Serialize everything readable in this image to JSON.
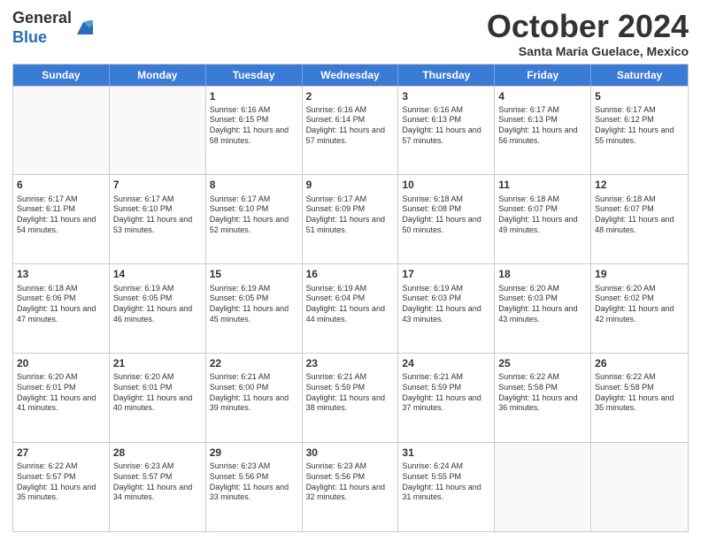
{
  "logo": {
    "general": "General",
    "blue": "Blue"
  },
  "header": {
    "month": "October 2024",
    "location": "Santa Maria Guelace, Mexico"
  },
  "days": [
    "Sunday",
    "Monday",
    "Tuesday",
    "Wednesday",
    "Thursday",
    "Friday",
    "Saturday"
  ],
  "weeks": [
    [
      {
        "day": "",
        "sunrise": "",
        "sunset": "",
        "daylight": "",
        "empty": true
      },
      {
        "day": "",
        "sunrise": "",
        "sunset": "",
        "daylight": "",
        "empty": true
      },
      {
        "day": "1",
        "sunrise": "Sunrise: 6:16 AM",
        "sunset": "Sunset: 6:15 PM",
        "daylight": "Daylight: 11 hours and 58 minutes.",
        "empty": false
      },
      {
        "day": "2",
        "sunrise": "Sunrise: 6:16 AM",
        "sunset": "Sunset: 6:14 PM",
        "daylight": "Daylight: 11 hours and 57 minutes.",
        "empty": false
      },
      {
        "day": "3",
        "sunrise": "Sunrise: 6:16 AM",
        "sunset": "Sunset: 6:13 PM",
        "daylight": "Daylight: 11 hours and 57 minutes.",
        "empty": false
      },
      {
        "day": "4",
        "sunrise": "Sunrise: 6:17 AM",
        "sunset": "Sunset: 6:13 PM",
        "daylight": "Daylight: 11 hours and 56 minutes.",
        "empty": false
      },
      {
        "day": "5",
        "sunrise": "Sunrise: 6:17 AM",
        "sunset": "Sunset: 6:12 PM",
        "daylight": "Daylight: 11 hours and 55 minutes.",
        "empty": false
      }
    ],
    [
      {
        "day": "6",
        "sunrise": "Sunrise: 6:17 AM",
        "sunset": "Sunset: 6:11 PM",
        "daylight": "Daylight: 11 hours and 54 minutes.",
        "empty": false
      },
      {
        "day": "7",
        "sunrise": "Sunrise: 6:17 AM",
        "sunset": "Sunset: 6:10 PM",
        "daylight": "Daylight: 11 hours and 53 minutes.",
        "empty": false
      },
      {
        "day": "8",
        "sunrise": "Sunrise: 6:17 AM",
        "sunset": "Sunset: 6:10 PM",
        "daylight": "Daylight: 11 hours and 52 minutes.",
        "empty": false
      },
      {
        "day": "9",
        "sunrise": "Sunrise: 6:17 AM",
        "sunset": "Sunset: 6:09 PM",
        "daylight": "Daylight: 11 hours and 51 minutes.",
        "empty": false
      },
      {
        "day": "10",
        "sunrise": "Sunrise: 6:18 AM",
        "sunset": "Sunset: 6:08 PM",
        "daylight": "Daylight: 11 hours and 50 minutes.",
        "empty": false
      },
      {
        "day": "11",
        "sunrise": "Sunrise: 6:18 AM",
        "sunset": "Sunset: 6:07 PM",
        "daylight": "Daylight: 11 hours and 49 minutes.",
        "empty": false
      },
      {
        "day": "12",
        "sunrise": "Sunrise: 6:18 AM",
        "sunset": "Sunset: 6:07 PM",
        "daylight": "Daylight: 11 hours and 48 minutes.",
        "empty": false
      }
    ],
    [
      {
        "day": "13",
        "sunrise": "Sunrise: 6:18 AM",
        "sunset": "Sunset: 6:06 PM",
        "daylight": "Daylight: 11 hours and 47 minutes.",
        "empty": false
      },
      {
        "day": "14",
        "sunrise": "Sunrise: 6:19 AM",
        "sunset": "Sunset: 6:05 PM",
        "daylight": "Daylight: 11 hours and 46 minutes.",
        "empty": false
      },
      {
        "day": "15",
        "sunrise": "Sunrise: 6:19 AM",
        "sunset": "Sunset: 6:05 PM",
        "daylight": "Daylight: 11 hours and 45 minutes.",
        "empty": false
      },
      {
        "day": "16",
        "sunrise": "Sunrise: 6:19 AM",
        "sunset": "Sunset: 6:04 PM",
        "daylight": "Daylight: 11 hours and 44 minutes.",
        "empty": false
      },
      {
        "day": "17",
        "sunrise": "Sunrise: 6:19 AM",
        "sunset": "Sunset: 6:03 PM",
        "daylight": "Daylight: 11 hours and 43 minutes.",
        "empty": false
      },
      {
        "day": "18",
        "sunrise": "Sunrise: 6:20 AM",
        "sunset": "Sunset: 6:03 PM",
        "daylight": "Daylight: 11 hours and 43 minutes.",
        "empty": false
      },
      {
        "day": "19",
        "sunrise": "Sunrise: 6:20 AM",
        "sunset": "Sunset: 6:02 PM",
        "daylight": "Daylight: 11 hours and 42 minutes.",
        "empty": false
      }
    ],
    [
      {
        "day": "20",
        "sunrise": "Sunrise: 6:20 AM",
        "sunset": "Sunset: 6:01 PM",
        "daylight": "Daylight: 11 hours and 41 minutes.",
        "empty": false
      },
      {
        "day": "21",
        "sunrise": "Sunrise: 6:20 AM",
        "sunset": "Sunset: 6:01 PM",
        "daylight": "Daylight: 11 hours and 40 minutes.",
        "empty": false
      },
      {
        "day": "22",
        "sunrise": "Sunrise: 6:21 AM",
        "sunset": "Sunset: 6:00 PM",
        "daylight": "Daylight: 11 hours and 39 minutes.",
        "empty": false
      },
      {
        "day": "23",
        "sunrise": "Sunrise: 6:21 AM",
        "sunset": "Sunset: 5:59 PM",
        "daylight": "Daylight: 11 hours and 38 minutes.",
        "empty": false
      },
      {
        "day": "24",
        "sunrise": "Sunrise: 6:21 AM",
        "sunset": "Sunset: 5:59 PM",
        "daylight": "Daylight: 11 hours and 37 minutes.",
        "empty": false
      },
      {
        "day": "25",
        "sunrise": "Sunrise: 6:22 AM",
        "sunset": "Sunset: 5:58 PM",
        "daylight": "Daylight: 11 hours and 36 minutes.",
        "empty": false
      },
      {
        "day": "26",
        "sunrise": "Sunrise: 6:22 AM",
        "sunset": "Sunset: 5:58 PM",
        "daylight": "Daylight: 11 hours and 35 minutes.",
        "empty": false
      }
    ],
    [
      {
        "day": "27",
        "sunrise": "Sunrise: 6:22 AM",
        "sunset": "Sunset: 5:57 PM",
        "daylight": "Daylight: 11 hours and 35 minutes.",
        "empty": false
      },
      {
        "day": "28",
        "sunrise": "Sunrise: 6:23 AM",
        "sunset": "Sunset: 5:57 PM",
        "daylight": "Daylight: 11 hours and 34 minutes.",
        "empty": false
      },
      {
        "day": "29",
        "sunrise": "Sunrise: 6:23 AM",
        "sunset": "Sunset: 5:56 PM",
        "daylight": "Daylight: 11 hours and 33 minutes.",
        "empty": false
      },
      {
        "day": "30",
        "sunrise": "Sunrise: 6:23 AM",
        "sunset": "Sunset: 5:56 PM",
        "daylight": "Daylight: 11 hours and 32 minutes.",
        "empty": false
      },
      {
        "day": "31",
        "sunrise": "Sunrise: 6:24 AM",
        "sunset": "Sunset: 5:55 PM",
        "daylight": "Daylight: 11 hours and 31 minutes.",
        "empty": false
      },
      {
        "day": "",
        "sunrise": "",
        "sunset": "",
        "daylight": "",
        "empty": true
      },
      {
        "day": "",
        "sunrise": "",
        "sunset": "",
        "daylight": "",
        "empty": true
      }
    ]
  ]
}
